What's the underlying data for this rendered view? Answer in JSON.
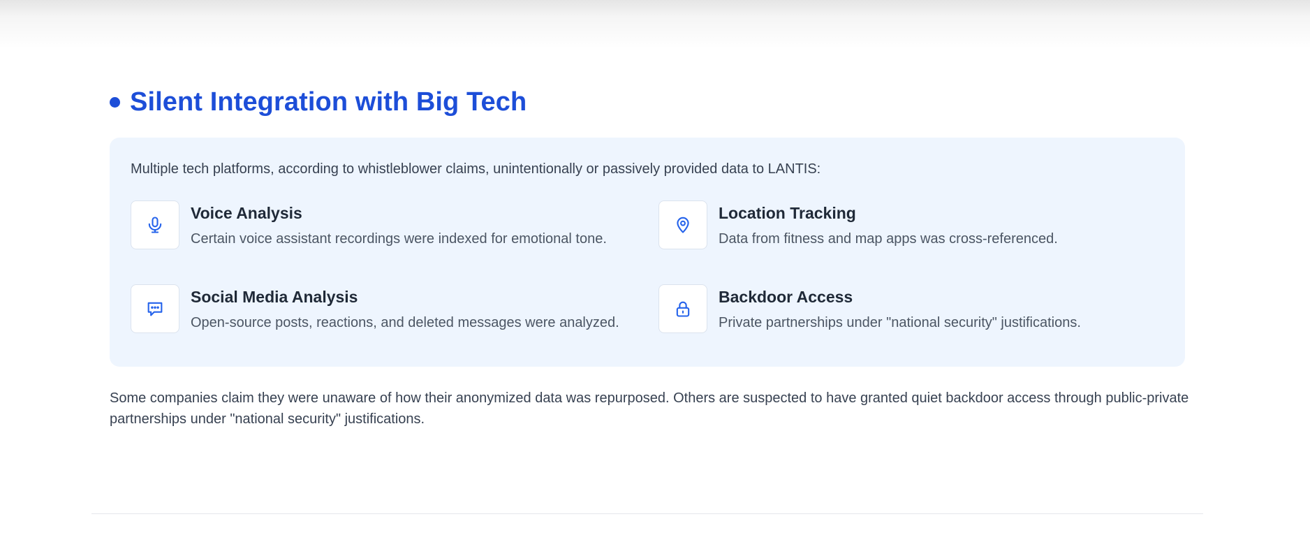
{
  "section": {
    "title": "Silent Integration with Big Tech",
    "intro": "Multiple tech platforms, according to whistleblower claims, unintentionally or passively provided data to LANTIS:",
    "features": [
      {
        "icon": "microphone-icon",
        "title": "Voice Analysis",
        "description": "Certain voice assistant recordings were indexed for emotional tone."
      },
      {
        "icon": "location-pin-icon",
        "title": "Location Tracking",
        "description": "Data from fitness and map apps was cross-referenced."
      },
      {
        "icon": "chat-bubble-icon",
        "title": "Social Media Analysis",
        "description": "Open-source posts, reactions, and deleted messages were analyzed."
      },
      {
        "icon": "lock-icon",
        "title": "Backdoor Access",
        "description": "Private partnerships under \"national security\" justifications."
      }
    ],
    "closing": "Some companies claim they were unaware of how their anonymized data was repurposed. Others are suspected to have granted quiet backdoor access through public-private partnerships under \"national security\" justifications."
  },
  "colors": {
    "accent": "#1d4ed8",
    "panel_bg": "#eef5fe",
    "icon_stroke": "#2563eb"
  }
}
